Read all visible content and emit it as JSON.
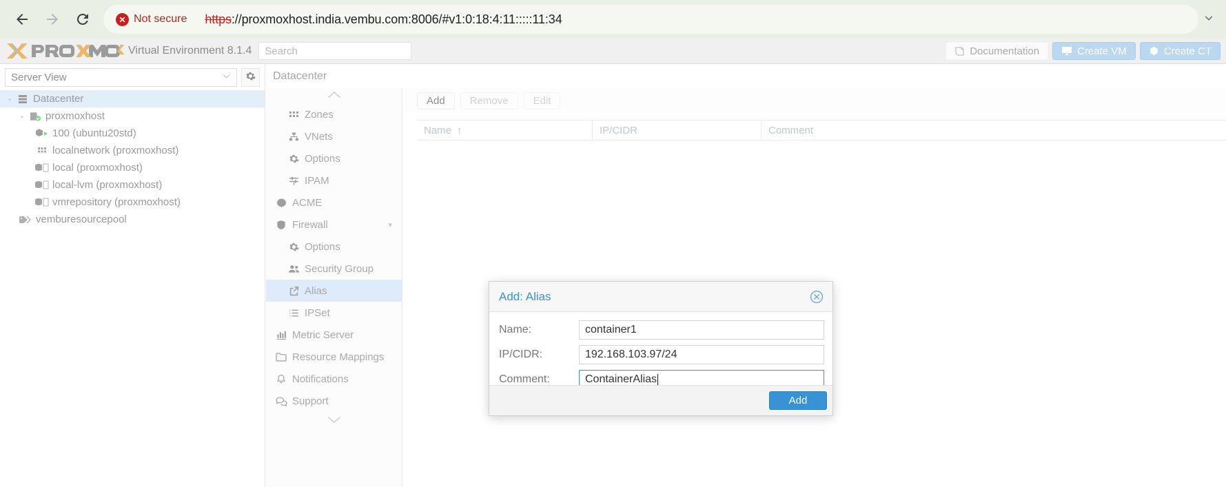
{
  "browser": {
    "back_icon": "back-arrow-icon",
    "forward_icon": "forward-arrow-icon",
    "reload_icon": "reload-icon",
    "security_label": "Not secure",
    "url_scheme": "https",
    "url_rest": "://proxmoxhost.india.vembu.com:8006/#v1:0:18:4:11:::::11:34",
    "full_url": "https://proxmoxhost.india.vembu.com:8006/#v1:0:18:4:11:::::11:34",
    "overflow_icon": "chevron-down-icon",
    "insecure_color": "#c5221f",
    "bar_color": "#e9efe2"
  },
  "pve_header": {
    "logo_text": "PROXMOX",
    "version": "Virtual Environment 8.1.4",
    "search_placeholder": "Search",
    "buttons": [
      {
        "label": "Documentation",
        "icon": "book-icon",
        "style": "plain"
      },
      {
        "label": "Create VM",
        "icon": "monitor-icon",
        "style": "blue"
      },
      {
        "label": "Create CT",
        "icon": "cube-icon",
        "style": "blue"
      }
    ],
    "accent_orange": "#e8b96a",
    "accent_blue": "#bcd8f0"
  },
  "sidebar": {
    "view_selector": "Server View",
    "view_caret_icon": "chevron-down-icon",
    "gear_icon": "gear-icon",
    "tree": [
      {
        "label": "Datacenter",
        "icon": "datacenter-icon",
        "indent": 0,
        "arrow": "expanded",
        "selected": true
      },
      {
        "label": "proxmoxhost",
        "icon": "node-icon",
        "indent": 1,
        "arrow": "expanded",
        "selected": false
      },
      {
        "label": "100 (ubuntu20std)",
        "icon": "container-running-icon",
        "indent": 2,
        "arrow": "none",
        "selected": false
      },
      {
        "label": "localnetwork (proxmoxhost)",
        "icon": "network-icon",
        "indent": 2,
        "arrow": "none",
        "selected": false
      },
      {
        "label": "local (proxmoxhost)",
        "icon": "storage-icon",
        "indent": 2,
        "arrow": "none",
        "selected": false
      },
      {
        "label": "local-lvm (proxmoxhost)",
        "icon": "storage-icon",
        "indent": 2,
        "arrow": "none",
        "selected": false
      },
      {
        "label": "vmrepository (proxmoxhost)",
        "icon": "storage-icon",
        "indent": 2,
        "arrow": "none",
        "selected": false
      },
      {
        "label": "vemburesourcepool",
        "icon": "tag-icon",
        "indent": 1,
        "arrow": "none",
        "selected": false
      }
    ]
  },
  "nav_menu": {
    "scroll_up_icon": "chevron-up-icon",
    "scroll_down_icon": "chevron-down-icon",
    "items": [
      {
        "label": "Zones",
        "icon": "grid-icon",
        "indent": true,
        "selected": false,
        "chevron": ""
      },
      {
        "label": "VNets",
        "icon": "sitemap-icon",
        "indent": true,
        "selected": false,
        "chevron": ""
      },
      {
        "label": "Options",
        "icon": "gear-icon",
        "indent": true,
        "selected": false,
        "chevron": ""
      },
      {
        "label": "IPAM",
        "icon": "sliders-icon",
        "indent": true,
        "selected": false,
        "chevron": ""
      },
      {
        "label": "ACME",
        "icon": "certificate-icon",
        "indent": false,
        "selected": false,
        "chevron": ""
      },
      {
        "label": "Firewall",
        "icon": "shield-icon",
        "indent": false,
        "selected": false,
        "chevron": "▾"
      },
      {
        "label": "Options",
        "icon": "gear-icon",
        "indent": true,
        "selected": false,
        "chevron": ""
      },
      {
        "label": "Security Group",
        "icon": "users-icon",
        "indent": true,
        "selected": false,
        "chevron": ""
      },
      {
        "label": "Alias",
        "icon": "external-link-icon",
        "indent": true,
        "selected": true,
        "chevron": ""
      },
      {
        "label": "IPSet",
        "icon": "ordered-list-icon",
        "indent": true,
        "selected": false,
        "chevron": ""
      },
      {
        "label": "Metric Server",
        "icon": "bar-chart-icon",
        "indent": false,
        "selected": false,
        "chevron": ""
      },
      {
        "label": "Resource Mappings",
        "icon": "folder-icon",
        "indent": false,
        "selected": false,
        "chevron": ""
      },
      {
        "label": "Notifications",
        "icon": "bell-icon",
        "indent": false,
        "selected": false,
        "chevron": ""
      },
      {
        "label": "Support",
        "icon": "comments-icon",
        "indent": false,
        "selected": false,
        "chevron": ""
      }
    ]
  },
  "main": {
    "breadcrumb": "Datacenter",
    "toolbar": [
      {
        "label": "Add",
        "disabled": false
      },
      {
        "label": "Remove",
        "disabled": true
      },
      {
        "label": "Edit",
        "disabled": true
      }
    ],
    "grid_columns": [
      {
        "label": "Name",
        "sort": "↑"
      },
      {
        "label": "IP/CIDR",
        "sort": ""
      },
      {
        "label": "Comment",
        "sort": ""
      }
    ],
    "grid_rows": []
  },
  "dialog": {
    "title": "Add: Alias",
    "close_icon": "close-circle-icon",
    "title_color": "#3892d4",
    "fields": [
      {
        "label": "Name:",
        "value": "container1",
        "focused": false
      },
      {
        "label": "IP/CIDR:",
        "value": "192.168.103.97/24",
        "focused": false
      },
      {
        "label": "Comment:",
        "value": "ContainerAlias",
        "focused": true
      }
    ],
    "submit_label": "Add",
    "submit_color": "#3892d4"
  }
}
